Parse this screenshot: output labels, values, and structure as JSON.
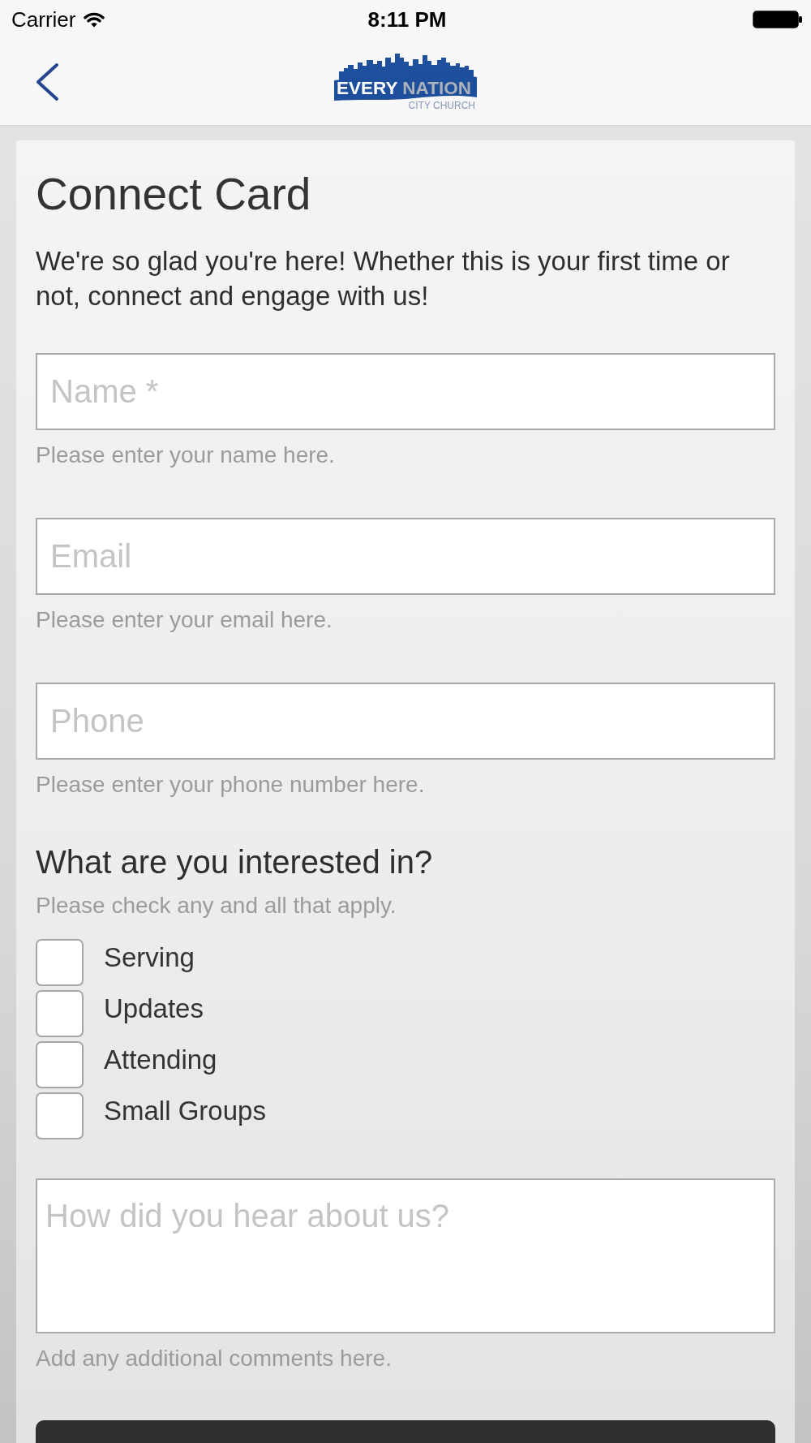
{
  "status_bar": {
    "carrier": "Carrier",
    "time": "8:11 PM"
  },
  "nav_bar": {
    "logo": {
      "wordmark": [
        "EVERY",
        "NATION"
      ],
      "tagline": "CITY CHURCH"
    }
  },
  "form": {
    "title": "Connect Card",
    "intro": "We're so glad you're here! Whether this is your first time or not, connect and engage with us!",
    "fields": [
      {
        "placeholder": "Name *",
        "help": "Please enter your name here."
      },
      {
        "placeholder": "Email",
        "help": "Please enter your email here."
      },
      {
        "placeholder": "Phone",
        "help": "Please enter your phone number here."
      }
    ],
    "interests": {
      "heading": "What are you interested in?",
      "hint": "Please check any and all that apply.",
      "options": [
        {
          "label": "Serving",
          "checked": false
        },
        {
          "label": "Updates",
          "checked": false
        },
        {
          "label": "Attending",
          "checked": false
        },
        {
          "label": "Small Groups",
          "checked": false
        }
      ]
    },
    "comments": {
      "placeholder": "How did you hear about us?",
      "help": "Add any additional comments here."
    }
  }
}
